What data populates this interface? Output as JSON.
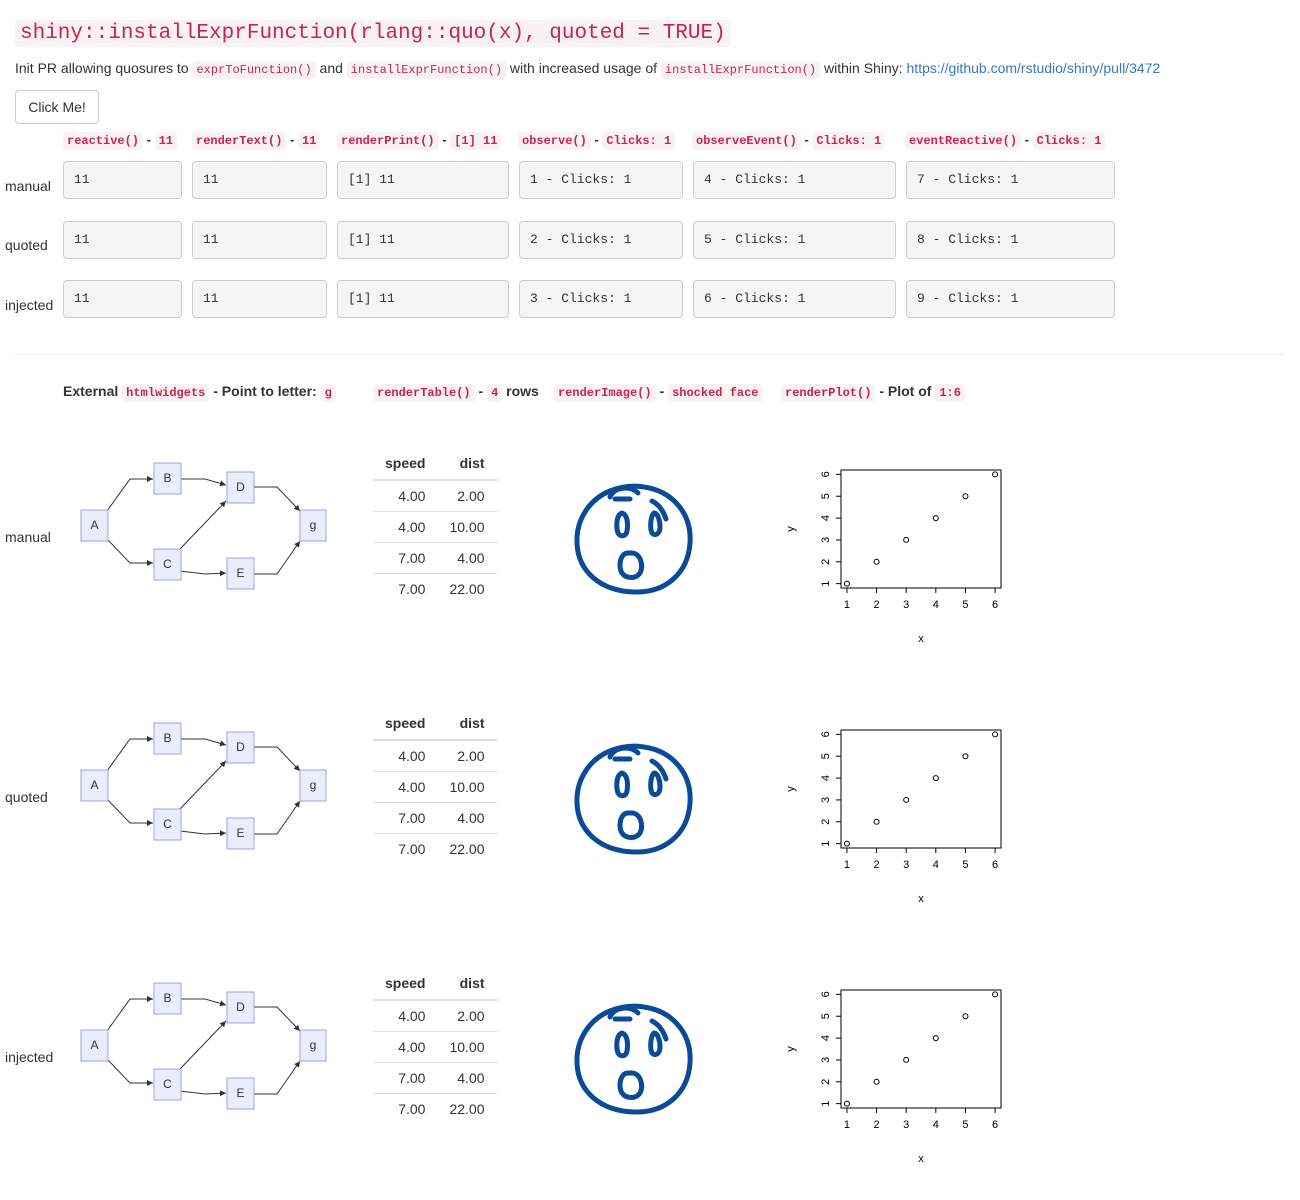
{
  "title": "shiny::installExprFunction(rlang::quo(x), quoted = TRUE)",
  "intro": {
    "prefix": "Init PR allowing quosures to",
    "fn1": "exprToFunction()",
    "and": "and",
    "fn2": "installExprFunction()",
    "mid": "with increased usage of",
    "fn3": "installExprFunction()",
    "suffix": "within Shiny:",
    "link_text": "https://github.com/rstudio/shiny/pull/3472"
  },
  "button": {
    "label": "Click Me!"
  },
  "sep": "-",
  "columns": [
    {
      "fn": "reactive()",
      "value": "11"
    },
    {
      "fn": "renderText()",
      "value": "11"
    },
    {
      "fn": "renderPrint()",
      "value": "[1] 11"
    },
    {
      "fn": "observe()",
      "value": "Clicks: 1"
    },
    {
      "fn": "observeEvent()",
      "value": "Clicks: 1"
    },
    {
      "fn": "eventReactive()",
      "value": "Clicks: 1"
    }
  ],
  "rows": [
    {
      "label": "manual",
      "cells": [
        "11",
        "11",
        "[1] 11",
        "1 - Clicks: 1",
        "4 - Clicks: 1",
        "7 - Clicks: 1"
      ]
    },
    {
      "label": "quoted",
      "cells": [
        "11",
        "11",
        "[1] 11",
        "2 - Clicks: 1",
        "5 - Clicks: 1",
        "8 - Clicks: 1"
      ]
    },
    {
      "label": "injected",
      "cells": [
        "11",
        "11",
        "[1] 11",
        "3 - Clicks: 1",
        "6 - Clicks: 1",
        "9 - Clicks: 1"
      ]
    }
  ],
  "section2": {
    "widgets": {
      "prefix": "External",
      "code": "htmlwidgets",
      "text": "- Point to letter:",
      "value": "g"
    },
    "table": {
      "code": "renderTable()",
      "value": "4",
      "text": "rows"
    },
    "image": {
      "code": "renderImage()",
      "value": "shocked face"
    },
    "plot": {
      "code": "renderPlot()",
      "text": "- Plot of",
      "value": "1:6"
    }
  },
  "row_labels": [
    "manual",
    "quoted",
    "injected"
  ],
  "dag_nodes": [
    "A",
    "B",
    "C",
    "D",
    "E",
    "g"
  ],
  "table": {
    "headers": [
      "speed",
      "dist"
    ],
    "rows": [
      [
        "4.00",
        "2.00"
      ],
      [
        "4.00",
        "10.00"
      ],
      [
        "7.00",
        "4.00"
      ],
      [
        "7.00",
        "22.00"
      ]
    ]
  },
  "image_icon": "shocked-face-drawing",
  "colors": {
    "code_text": "#c7254e",
    "code_bg": "#f9f2f4",
    "link": "#337ab7",
    "face_stroke": "#0a4a96",
    "node_fill": "#ececff"
  },
  "chart_data": {
    "type": "scatter",
    "x": [
      1,
      2,
      3,
      4,
      5,
      6
    ],
    "y": [
      1,
      2,
      3,
      4,
      5,
      6
    ],
    "xlabel": "x",
    "ylabel": "y",
    "xlim": [
      1,
      6
    ],
    "ylim": [
      1,
      6
    ],
    "xticks": [
      "1",
      "2",
      "3",
      "4",
      "5",
      "6"
    ],
    "yticks": [
      "1",
      "2",
      "3",
      "4",
      "5",
      "6"
    ]
  }
}
